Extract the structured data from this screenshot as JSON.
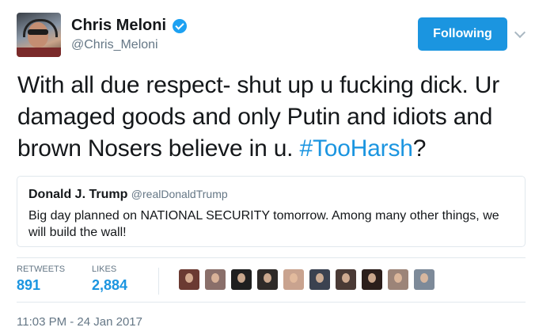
{
  "author": {
    "display_name": "Chris Meloni",
    "handle": "@Chris_Meloni",
    "verified": true
  },
  "follow_button": {
    "label": "Following"
  },
  "tweet": {
    "text_before_hashtag": "With all due respect- shut up u fucking dick. Ur damaged goods and only Putin and idiots and brown Nosers believe in u. ",
    "hashtag": "#TooHarsh",
    "text_after_hashtag": "?"
  },
  "quoted_tweet": {
    "display_name": "Donald J. Trump",
    "handle": "@realDonaldTrump",
    "text": "Big day planned on NATIONAL SECURITY tomorrow. Among many other things, we will build the wall!"
  },
  "stats": {
    "retweets_label": "RETWEETS",
    "retweets_value": "891",
    "likes_label": "LIKES",
    "likes_value": "2,884"
  },
  "likers": [
    {
      "name": "liker-1",
      "color": "#6b3a32"
    },
    {
      "name": "liker-2",
      "color": "#8a6f6a"
    },
    {
      "name": "liker-3",
      "color": "#1f1f1f"
    },
    {
      "name": "liker-4",
      "color": "#2e2a28"
    },
    {
      "name": "liker-5",
      "color": "#c9a38f"
    },
    {
      "name": "liker-6",
      "color": "#3b4250"
    },
    {
      "name": "liker-7",
      "color": "#4a3a35"
    },
    {
      "name": "liker-8",
      "color": "#2b1e1b"
    },
    {
      "name": "liker-9",
      "color": "#9c8478"
    },
    {
      "name": "liker-10",
      "color": "#7d8a99"
    }
  ],
  "timestamp": "11:03 PM - 24 Jan 2017",
  "colors": {
    "accent": "#1b95e0",
    "text_primary": "#14171a",
    "text_secondary": "#657786",
    "border": "#e1e8ed"
  }
}
